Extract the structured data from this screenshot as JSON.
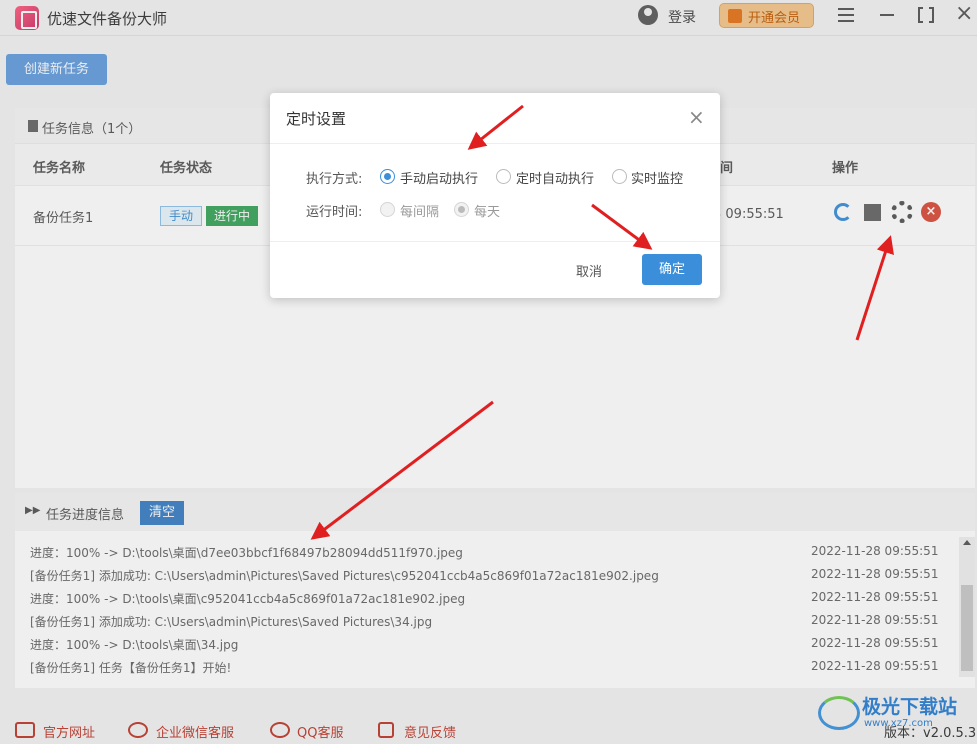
{
  "app": {
    "title": "优速文件备份大师",
    "login": "登录",
    "vip": "开通会员"
  },
  "toolbar": {
    "create_task": "创建新任务"
  },
  "task_panel": {
    "title": "任务信息（1个）",
    "columns": [
      "任务名称",
      "任务状态",
      "间",
      "操作"
    ],
    "rows": [
      {
        "name": "备份任务1",
        "mode_tag": "手动",
        "status_tag": "进行中",
        "time": "3 09:55:51",
        "actions": [
          "refresh-icon",
          "stop-icon",
          "gear-icon",
          "delete-icon"
        ]
      }
    ]
  },
  "dialog": {
    "title": "定时设置",
    "exec_label": "执行方式:",
    "exec_options": [
      "手动启动执行",
      "定时自动执行",
      "实时监控"
    ],
    "exec_selected": "手动启动执行",
    "run_label": "运行时间:",
    "run_options": [
      "每间隔",
      "每天"
    ],
    "run_selected": "每天",
    "cancel": "取消",
    "ok": "确定"
  },
  "progress_panel": {
    "title": "任务进度信息",
    "clear": "清空",
    "logs": [
      {
        "text": "进度：100% -> D:\\tools\\桌面\\d7ee03bbcf1f68497b28094dd511f970.jpeg",
        "time": "2022-11-28 09:55:51"
      },
      {
        "text": "[备份任务1] 添加成功:   C:\\Users\\admin\\Pictures\\Saved Pictures\\c952041ccb4a5c869f01a72ac181e902.jpeg",
        "time": "2022-11-28 09:55:51"
      },
      {
        "text": "进度：100% -> D:\\tools\\桌面\\c952041ccb4a5c869f01a72ac181e902.jpeg",
        "time": "2022-11-28 09:55:51"
      },
      {
        "text": "[备份任务1] 添加成功:   C:\\Users\\admin\\Pictures\\Saved Pictures\\34.jpg",
        "time": "2022-11-28 09:55:51"
      },
      {
        "text": "进度：100% -> D:\\tools\\桌面\\34.jpg",
        "time": "2022-11-28 09:55:51"
      },
      {
        "text": "[备份任务1] 任务【备份任务1】开始!",
        "time": "2022-11-28 09:55:51"
      }
    ]
  },
  "bottom_bar": {
    "links": [
      "官方网址",
      "企业微信客服",
      "QQ客服",
      "意见反馈"
    ],
    "version": "版本：v2.0.5.3"
  },
  "watermark": {
    "main": "极光下载站",
    "sub": "www.xz7.com"
  },
  "colors": {
    "primary": "#3b8ed9",
    "success": "#3aa55a",
    "danger": "#d94d3b",
    "annotation": "#e02020"
  }
}
